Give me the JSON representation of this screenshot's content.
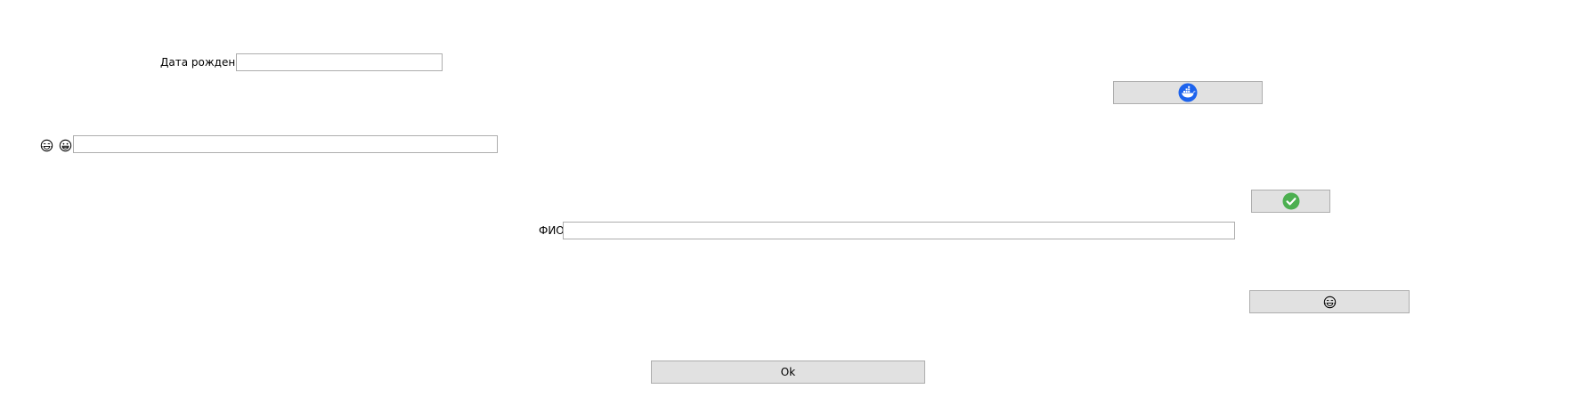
{
  "form": {
    "birthdate_label": "Дата рождения",
    "birthdate_value": "",
    "emoji_field_value": "",
    "fio_label": "ФИО",
    "fio_value": "",
    "ok_label": "Ok"
  },
  "icons": {
    "docker_button_icon": "docker-icon",
    "check_button_icon": "check-icon",
    "emoji_button_icon": "crying-laughing-face-icon",
    "emoji_label_icon_1": "crying-laughing-face-icon",
    "emoji_label_icon_2": "grinning-face-icon"
  },
  "colors": {
    "button_bg": "#e1e1e1",
    "button_border": "#adadad",
    "docker_blue": "#1d63ed",
    "check_green": "#4caf50"
  }
}
